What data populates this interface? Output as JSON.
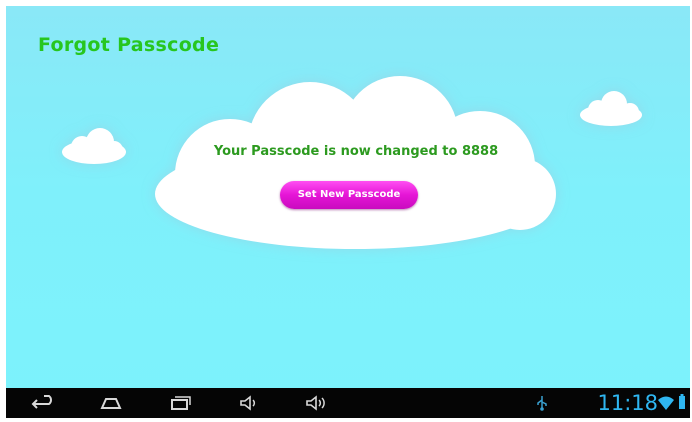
{
  "screen": {
    "title": "Forgot Passcode",
    "message": "Your Passcode is now changed to 8888",
    "button_label": "Set New Passcode"
  },
  "navbar": {
    "clock": "11:18",
    "icons": [
      "back-icon",
      "home-icon",
      "recent-apps-icon",
      "volume-down-icon",
      "volume-up-icon",
      "usb-icon",
      "wifi-icon",
      "battery-icon"
    ]
  },
  "colors": {
    "background": "#7cf0fb",
    "title": "#27c61f",
    "message": "#2c9a1f",
    "button": "#e515d6",
    "clock": "#2fb6f0",
    "navbar": "#050505"
  }
}
